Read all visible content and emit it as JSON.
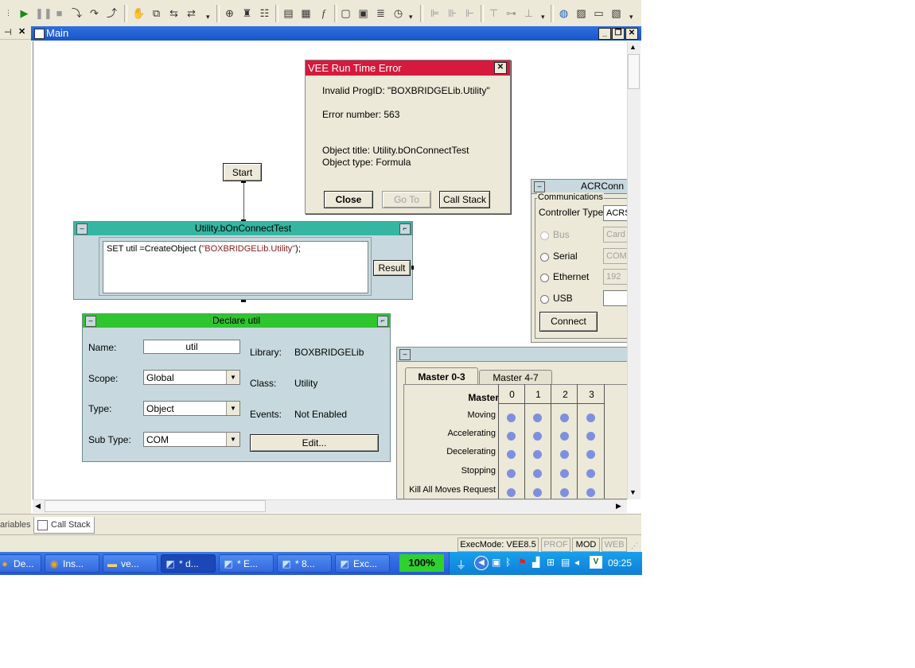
{
  "main": {
    "title": "Main"
  },
  "error_dialog": {
    "title": "VEE Run Time Error",
    "line1": "Invalid ProgID: \"BOXBRIDGELib.Utility\"",
    "line2": "Error number: 563",
    "line3": "Object title: Utility.bOnConnectTest",
    "line4": "Object type: Formula",
    "close": "Close",
    "goto": "Go To",
    "callstack": "Call Stack"
  },
  "start": {
    "label": "Start"
  },
  "formula": {
    "title": "Utility.bOnConnectTest",
    "code_prefix": "SET util =CreateObject (",
    "code_string": "\"BOXBRIDGELib.Utility\"",
    "code_suffix": ");",
    "result": "Result"
  },
  "declare": {
    "title": "Declare util",
    "name_label": "Name:",
    "name_value": "util",
    "scope_label": "Scope:",
    "scope_value": "Global",
    "type_label": "Type:",
    "type_value": "Object",
    "subtype_label": "Sub Type:",
    "subtype_value": "COM",
    "library_label": "Library:",
    "library_value": "BOXBRIDGELib",
    "class_label": "Class:",
    "class_value": "Utility",
    "events_label": "Events:",
    "events_value": "Not Enabled",
    "edit": "Edit..."
  },
  "acr": {
    "title": "ACRConn",
    "group": "Communications",
    "controller_label": "Controller Type",
    "controller_value": "ACRS",
    "bus": "Bus",
    "bus_value": "Card",
    "serial": "Serial",
    "serial_value": "COM",
    "ethernet": "Ethernet",
    "ethernet_value": "192",
    "usb": "USB",
    "connect": "Connect"
  },
  "master": {
    "tab1": "Master 0-3",
    "tab2": "Master 4-7",
    "header": "Master",
    "cols": [
      "0",
      "1",
      "2",
      "3"
    ],
    "rows": [
      "Moving",
      "Accelerating",
      "Decelerating",
      "Stopping",
      "Kill All Moves Request"
    ]
  },
  "bottom_tabs": {
    "variables": "ariables",
    "callstack": "Call Stack"
  },
  "status": {
    "execmode": "ExecMode: VEE8.5",
    "prof": "PROF",
    "mod": "MOD",
    "web": "WEB"
  },
  "taskbar": {
    "items": [
      "De...",
      "Ins...",
      "ve...",
      "* d...",
      "* E...",
      "* 8...",
      "Exc..."
    ],
    "zoom": "100%",
    "clock": "09:25"
  }
}
